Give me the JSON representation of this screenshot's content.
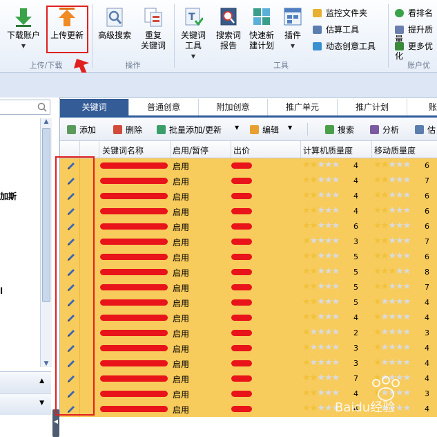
{
  "ribbon": {
    "buttons": [
      {
        "label_line1": "下载账户",
        "label_line2": "",
        "icon": "download-arrow-icon",
        "color": "#3aa34a"
      },
      {
        "label_line1": "上传更新",
        "label_line2": "",
        "icon": "upload-arrow-icon",
        "color": "#f08a24"
      },
      {
        "label_line1": "高级搜索",
        "label_line2": "",
        "icon": "magnifier-doc-icon",
        "color": "#5a7fae"
      },
      {
        "label_line1": "重复",
        "label_line2": "关键词",
        "icon": "duplicate-doc-icon",
        "color": "#d24a3a"
      },
      {
        "label_line1": "关键词",
        "label_line2": "工具",
        "icon": "keyword-tool-icon",
        "color": "#3a8a3a"
      },
      {
        "label_line1": "搜索词",
        "label_line2": "报告",
        "icon": "search-report-icon",
        "color": "#4a6fa5"
      },
      {
        "label_line1": "快速新",
        "label_line2": "建计划",
        "icon": "quick-plan-icon",
        "color": "#3a9e8a"
      },
      {
        "label_line1": "插件",
        "label_line2": "",
        "icon": "plugin-icon",
        "color": "#4f7fc0"
      }
    ],
    "small_items": [
      {
        "label": "监控文件夹",
        "icon": "folder-icon",
        "color": "#e8b030"
      },
      {
        "label": "估算工具",
        "icon": "estimate-icon",
        "color": "#5a7fae"
      },
      {
        "label": "动态创意工具",
        "icon": "dynamic-creative-icon",
        "color": "#3a8fd0"
      },
      {
        "label": "看排名",
        "icon": "rank-icon",
        "color": "#3aa34a"
      },
      {
        "label": "提升质量",
        "icon": "quality-icon",
        "color": "#6b7fae"
      },
      {
        "label": "更多优化",
        "icon": "more-optimize-icon",
        "color": "#3a8a3a"
      }
    ],
    "groups": [
      "上传/下载",
      "操作",
      "工具",
      "账户优"
    ]
  },
  "left_panel": {
    "text1": "加斯",
    "text2": "l"
  },
  "tabs": [
    "关键词",
    "普通创意",
    "附加创意",
    "推广单元",
    "推广计划",
    "账"
  ],
  "toolbar": {
    "add": "添加",
    "delete": "删除",
    "batch": "批量添加/更新",
    "edit": "编辑",
    "search": "搜索",
    "analyze": "分析",
    "estimate": "估"
  },
  "grid": {
    "headers": [
      "关键词名称",
      "启用/暂停",
      "出价",
      "计算机质量度",
      "移动质量度"
    ],
    "rows": [
      {
        "status": "启用",
        "pc_stars": 2,
        "pc_quality": "4",
        "mobile_stars": 2,
        "mobile_quality": "6"
      },
      {
        "status": "启用",
        "pc_stars": 2,
        "pc_quality": "4",
        "mobile_stars": 2,
        "mobile_quality": "7"
      },
      {
        "status": "启用",
        "pc_stars": 2,
        "pc_quality": "4",
        "mobile_stars": 2,
        "mobile_quality": "6"
      },
      {
        "status": "启用",
        "pc_stars": 2,
        "pc_quality": "4",
        "mobile_stars": 2,
        "mobile_quality": "6"
      },
      {
        "status": "启用",
        "pc_stars": 2,
        "pc_quality": "6",
        "mobile_stars": 2,
        "mobile_quality": "6"
      },
      {
        "status": "启用",
        "pc_stars": 1,
        "pc_quality": "3",
        "mobile_stars": 2,
        "mobile_quality": "7"
      },
      {
        "status": "启用",
        "pc_stars": 2,
        "pc_quality": "5",
        "mobile_stars": 2,
        "mobile_quality": "6"
      },
      {
        "status": "启用",
        "pc_stars": 2,
        "pc_quality": "5",
        "mobile_stars": 3,
        "mobile_quality": "8"
      },
      {
        "status": "启用",
        "pc_stars": 2,
        "pc_quality": "5",
        "mobile_stars": 2,
        "mobile_quality": "7"
      },
      {
        "status": "启用",
        "pc_stars": 2,
        "pc_quality": "5",
        "mobile_stars": 1,
        "mobile_quality": "4"
      },
      {
        "status": "启用",
        "pc_stars": 2,
        "pc_quality": "4",
        "mobile_stars": 1,
        "mobile_quality": "4"
      },
      {
        "status": "启用",
        "pc_stars": 1,
        "pc_quality": "2",
        "mobile_stars": 1,
        "mobile_quality": "3"
      },
      {
        "status": "启用",
        "pc_stars": 1,
        "pc_quality": "3",
        "mobile_stars": 1,
        "mobile_quality": "4"
      },
      {
        "status": "启用",
        "pc_stars": 1,
        "pc_quality": "3",
        "mobile_stars": 1,
        "mobile_quality": "4"
      },
      {
        "status": "启用",
        "pc_stars": 2,
        "pc_quality": "7",
        "mobile_stars": 1,
        "mobile_quality": "4"
      },
      {
        "status": "启用",
        "pc_stars": 2,
        "pc_quality": "4",
        "mobile_stars": 1,
        "mobile_quality": "3"
      },
      {
        "status": "启用",
        "pc_stars": 2,
        "pc_quality": "4",
        "mobile_stars": 1,
        "mobile_quality": "4"
      }
    ]
  },
  "watermark": "Baidu经验",
  "colors": {
    "highlight": "#e02020",
    "row_bg": "#f7cb5c",
    "tab_active": "#345c97"
  }
}
